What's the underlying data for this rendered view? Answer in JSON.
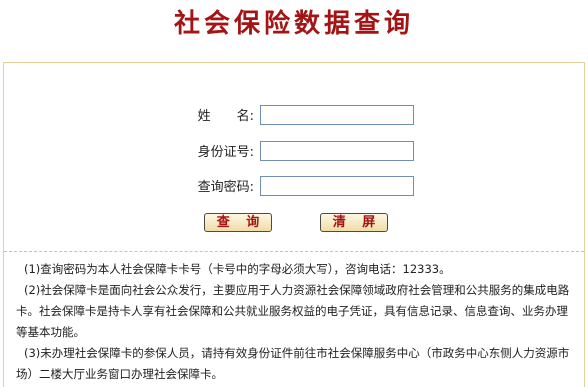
{
  "header": {
    "title": "社会保险数据查询"
  },
  "form": {
    "fields": [
      {
        "label": "姓　　名:",
        "value": "",
        "placeholder": ""
      },
      {
        "label": "身份证号:",
        "value": "",
        "placeholder": ""
      },
      {
        "label": "查询密码:",
        "value": "",
        "placeholder": ""
      }
    ],
    "buttons": {
      "query_label": "查 询",
      "clear_label": "清 屏"
    }
  },
  "notes": [
    "(1)查询密码为本人社会保障卡卡号（卡号中的字母必须大写），咨询电话：12333。",
    "(2)社会保障卡是面向社会公众发行，主要应用于人力资源社会保障领域政府社会管理和公共服务的集成电路卡。社会保障卡是持卡人享有社会保障和公共就业服务权益的电子凭证，具有信息记录、信息查询、业务办理等基本功能。",
    "(3)未办理社会保障卡的参保人员，请持有效身份证件前往市社会保障服务中心（市政务中心东侧人力资源市场）二楼大厅业务窗口办理社会保障卡。"
  ],
  "colors": {
    "title": "#a51414",
    "panel_border": "#e8cf9a",
    "input_border": "#6f8fb8",
    "button_bg": "#f1dca6"
  }
}
